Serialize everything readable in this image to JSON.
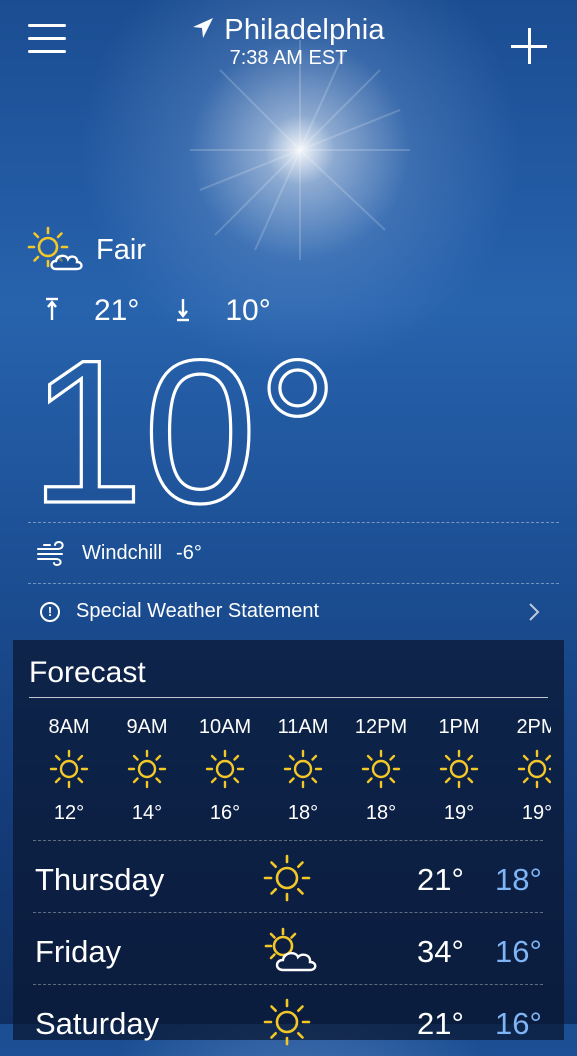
{
  "header": {
    "city": "Philadelphia",
    "time": "7:38 AM EST",
    "menu_icon": "hamburger-menu-icon",
    "add_icon": "plus-icon",
    "location_icon": "location-arrow-icon"
  },
  "current": {
    "condition": "Fair",
    "condition_icon": "sun-cloud-icon",
    "high": "21°",
    "low": "10°",
    "temperature": "10°",
    "windchill_label": "Windchill",
    "windchill_value": "-6°"
  },
  "alert": {
    "text": "Special Weather Statement"
  },
  "forecast": {
    "title": "Forecast",
    "hourly": [
      {
        "hour": "8AM",
        "temp": "12°"
      },
      {
        "hour": "9AM",
        "temp": "14°"
      },
      {
        "hour": "10AM",
        "temp": "16°"
      },
      {
        "hour": "11AM",
        "temp": "18°"
      },
      {
        "hour": "12PM",
        "temp": "18°"
      },
      {
        "hour": "1PM",
        "temp": "19°"
      },
      {
        "hour": "2PM",
        "temp": "19°"
      }
    ],
    "daily": [
      {
        "day": "Thursday",
        "icon": "sun-icon",
        "high": "21°",
        "low": "18°"
      },
      {
        "day": "Friday",
        "icon": "sun-cloud-icon",
        "high": "34°",
        "low": "16°"
      },
      {
        "day": "Saturday",
        "icon": "sun-icon",
        "high": "21°",
        "low": "16°"
      }
    ]
  },
  "colors": {
    "sky_top": "#1b4d92",
    "sky_bottom": "#0f2f62",
    "sun_icon": "#f3c728",
    "low_temp": "#7fb4f5"
  }
}
